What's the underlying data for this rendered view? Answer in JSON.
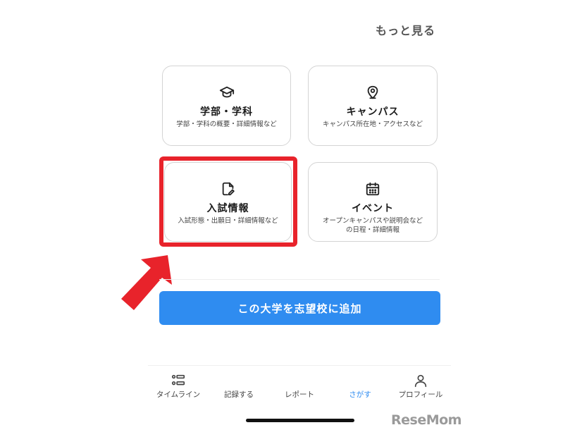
{
  "header": {
    "more_label": "もっと見る"
  },
  "cards": [
    {
      "title": "学部・学科",
      "subtitle": "学部・学科の概要・詳細情報など",
      "icon": "graduation-cap-icon"
    },
    {
      "title": "キャンパス",
      "subtitle": "キャンパス所在地・アクセスなど",
      "icon": "map-pin-icon"
    },
    {
      "title": "入試情報",
      "subtitle": "入試形態・出願日・詳細情報など",
      "icon": "document-edit-icon"
    },
    {
      "title": "イベント",
      "subtitle": "オープンキャンパスや説明会など\nの日程・詳細情報",
      "icon": "calendar-icon"
    }
  ],
  "add_button": {
    "label": "この大学を志望校に追加"
  },
  "tabbar": {
    "tabs": [
      {
        "label": "タイムライン",
        "icon": "timeline-icon",
        "active": false
      },
      {
        "label": "記録する",
        "icon": "none",
        "active": false
      },
      {
        "label": "レポート",
        "icon": "none",
        "active": false
      },
      {
        "label": "さがす",
        "icon": "none",
        "active": true
      },
      {
        "label": "プロフィール",
        "icon": "profile-icon",
        "active": false
      }
    ]
  },
  "colors": {
    "accent": "#2f8cf0",
    "highlight": "#e8232b",
    "card_border": "#d4d4d4"
  },
  "watermark": {
    "text": "ReseMom"
  }
}
